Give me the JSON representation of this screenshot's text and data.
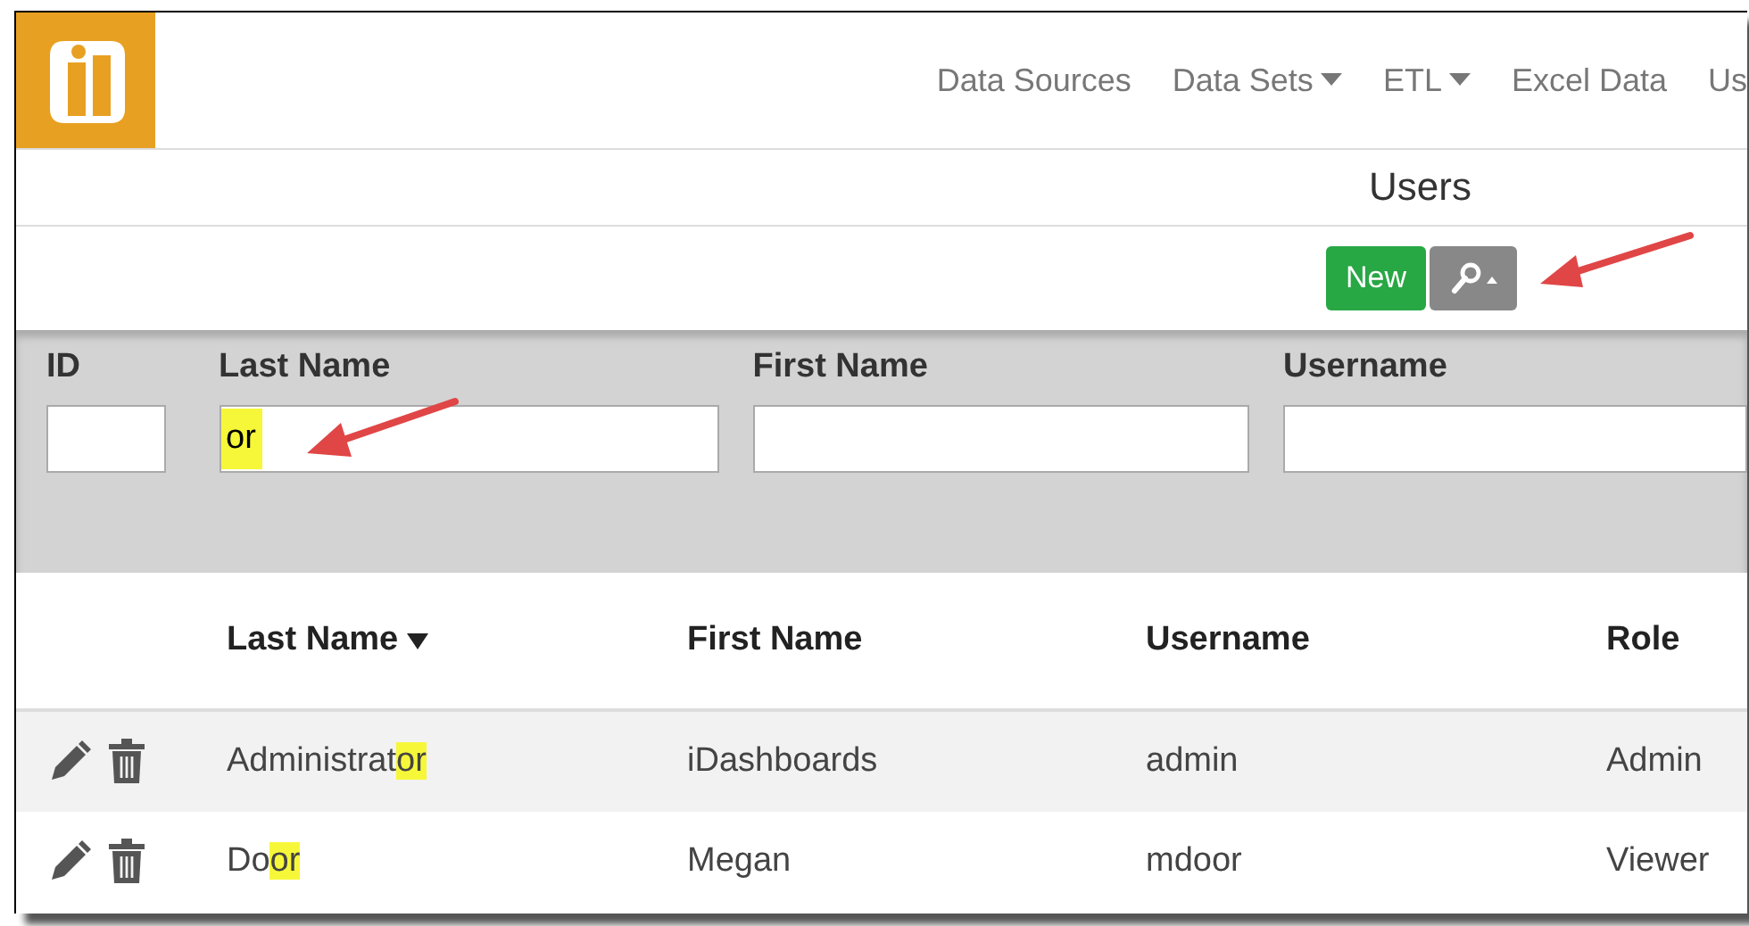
{
  "nav": [
    {
      "label": "Data Sources",
      "dropdown": false
    },
    {
      "label": "Data Sets",
      "dropdown": true
    },
    {
      "label": "ETL",
      "dropdown": true
    },
    {
      "label": "Excel Data",
      "dropdown": false
    },
    {
      "label": "Us",
      "dropdown": false
    }
  ],
  "page_title": "Users",
  "toolbar": {
    "new_button": "New"
  },
  "filters": [
    {
      "label": "ID"
    },
    {
      "label": "Last Name",
      "value": "or",
      "highlight": true
    },
    {
      "label": "First Name"
    },
    {
      "label": "Username"
    }
  ],
  "table": {
    "columns": [
      {
        "label": "Last Name",
        "sorted": true
      },
      {
        "label": "First Name",
        "sorted": false
      },
      {
        "label": "Username",
        "sorted": false
      },
      {
        "label": "Role",
        "sorted": false
      }
    ],
    "rows": [
      {
        "last_name": [
          {
            "text": "Administrat",
            "highlight": false
          },
          {
            "text": "or",
            "highlight": true
          }
        ],
        "first_name": "iDashboards",
        "username": "admin",
        "role": "Admin",
        "shaded": true
      },
      {
        "last_name": [
          {
            "text": "Do",
            "highlight": false
          },
          {
            "text": "or",
            "highlight": true
          }
        ],
        "first_name": "Megan",
        "username": "mdoor",
        "role": "Viewer",
        "shaded": false
      }
    ]
  }
}
